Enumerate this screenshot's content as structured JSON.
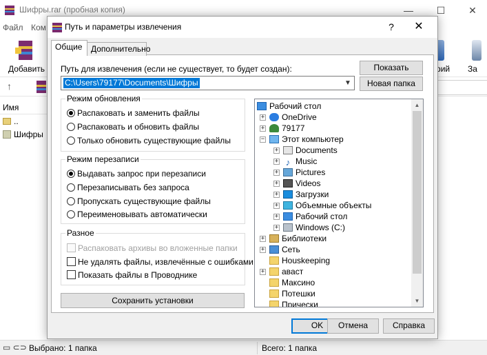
{
  "background": {
    "title": "Шифры.rar (пробная копия)",
    "menu": [
      "Файл",
      "Ком"
    ],
    "toolbar": {
      "add": "Добавить",
      "comment": "тарий",
      "za": "За"
    },
    "list_header": {
      "name": "Имя"
    },
    "rows": [
      "..",
      "Шифры"
    ],
    "status": {
      "left": "Выбрано: 1 папка",
      "right": "Всего: 1 папка"
    }
  },
  "dialog": {
    "title": "Путь и параметры извлечения",
    "help_glyph": "?",
    "close_glyph": "✕",
    "tabs": {
      "general": "Общие",
      "advanced": "Дополнительно"
    },
    "path": {
      "label": "Путь для извлечения (если не существует, то будет создан):",
      "value": "C:\\Users\\79177\\Documents\\Шифры"
    },
    "buttons": {
      "show": "Показать",
      "new_folder": "Новая папка",
      "save": "Сохранить установки",
      "ok": "OK",
      "cancel": "Отмена",
      "help": "Справка"
    },
    "update_mode": {
      "title": "Режим обновления",
      "options": [
        "Распаковать и заменить файлы",
        "Распаковать и обновить файлы",
        "Только обновить существующие файлы"
      ],
      "selected": 0
    },
    "overwrite_mode": {
      "title": "Режим перезаписи",
      "options": [
        "Выдавать запрос при перезаписи",
        "Перезаписывать без запроса",
        "Пропускать существующие файлы",
        "Переименовывать автоматически"
      ],
      "selected": 0
    },
    "misc": {
      "title": "Разное",
      "options": [
        "Распаковать архивы во вложенные папки",
        "Не удалять файлы, извлечённые с ошибками",
        "Показать файлы в Проводнике"
      ]
    },
    "tree": [
      "Рабочий стол",
      "OneDrive",
      "79177",
      "Этот компьютер",
      "Documents",
      "Music",
      "Pictures",
      "Videos",
      "Загрузки",
      "Объемные объекты",
      "Рабочий стол",
      "Windows (C:)",
      "Библиотеки",
      "Сеть",
      "Houskeeping",
      "авaст",
      "Максино",
      "Потешки",
      "Прически"
    ]
  },
  "colors": {
    "accent": "#0078d7",
    "dialog_bg": "#f0f0f0"
  }
}
